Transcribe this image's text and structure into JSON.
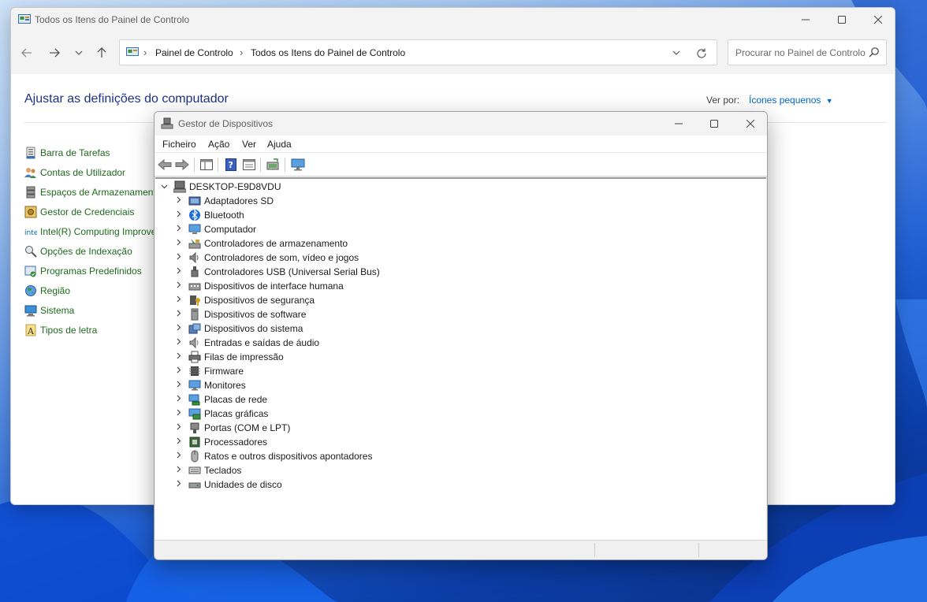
{
  "cp_window": {
    "title": "Todos os Itens do Painel de Controlo",
    "breadcrumb": [
      "Painel de Controlo",
      "Todos os Itens do Painel de Controlo"
    ],
    "search_placeholder": "Procurar no Painel de Controlo",
    "heading": "Ajustar as definições do computador",
    "viewby_label": "Ver por:",
    "viewby_value": "Ícones pequenos",
    "items": [
      {
        "label": "Barra de Tarefas",
        "icon": "taskbar-icon"
      },
      {
        "label": "Contas de Utilizador",
        "icon": "user-accounts-icon"
      },
      {
        "label": "Espaços de Armazenamento",
        "icon": "storage-spaces-icon"
      },
      {
        "label": "Gestor de Credenciais",
        "icon": "credential-manager-icon"
      },
      {
        "label": "Intel(R) Computing Improvement Program",
        "icon": "intel-icon"
      },
      {
        "label": "Opções de Indexação",
        "icon": "indexing-options-icon"
      },
      {
        "label": "Programas Predefinidos",
        "icon": "default-programs-icon"
      },
      {
        "label": "Região",
        "icon": "region-icon"
      },
      {
        "label": "Sistema",
        "icon": "system-icon"
      },
      {
        "label": "Tipos de letra",
        "icon": "fonts-icon"
      }
    ]
  },
  "dm_window": {
    "title": "Gestor de Dispositivos",
    "menu": [
      "Ficheiro",
      "Ação",
      "Ver",
      "Ajuda"
    ],
    "root": "DESKTOP-E9D8VDU",
    "categories": [
      {
        "label": "Adaptadores SD",
        "icon": "sd-adapter-icon"
      },
      {
        "label": "Bluetooth",
        "icon": "bluetooth-icon"
      },
      {
        "label": "Computador",
        "icon": "computer-icon"
      },
      {
        "label": "Controladores de armazenamento",
        "icon": "storage-controller-icon"
      },
      {
        "label": "Controladores de som, vídeo e jogos",
        "icon": "sound-icon"
      },
      {
        "label": "Controladores USB (Universal Serial Bus)",
        "icon": "usb-icon"
      },
      {
        "label": "Dispositivos de interface humana",
        "icon": "hid-icon"
      },
      {
        "label": "Dispositivos de segurança",
        "icon": "security-device-icon"
      },
      {
        "label": "Dispositivos de software",
        "icon": "software-device-icon"
      },
      {
        "label": "Dispositivos do sistema",
        "icon": "system-device-icon"
      },
      {
        "label": "Entradas e saídas de áudio",
        "icon": "audio-io-icon"
      },
      {
        "label": "Filas de impressão",
        "icon": "printer-icon"
      },
      {
        "label": "Firmware",
        "icon": "firmware-icon"
      },
      {
        "label": "Monitores",
        "icon": "monitor-icon"
      },
      {
        "label": "Placas de rede",
        "icon": "network-adapter-icon"
      },
      {
        "label": "Placas gráficas",
        "icon": "display-adapter-icon"
      },
      {
        "label": "Portas (COM e LPT)",
        "icon": "ports-icon"
      },
      {
        "label": "Processadores",
        "icon": "processor-icon"
      },
      {
        "label": "Ratos e outros dispositivos apontadores",
        "icon": "mouse-icon"
      },
      {
        "label": "Teclados",
        "icon": "keyboard-icon"
      },
      {
        "label": "Unidades de disco",
        "icon": "disk-drive-icon"
      }
    ]
  },
  "colors": {
    "cp_heading": "#1e3287",
    "cp_link": "#1e6a1e",
    "viewby_link": "#0066cc"
  }
}
